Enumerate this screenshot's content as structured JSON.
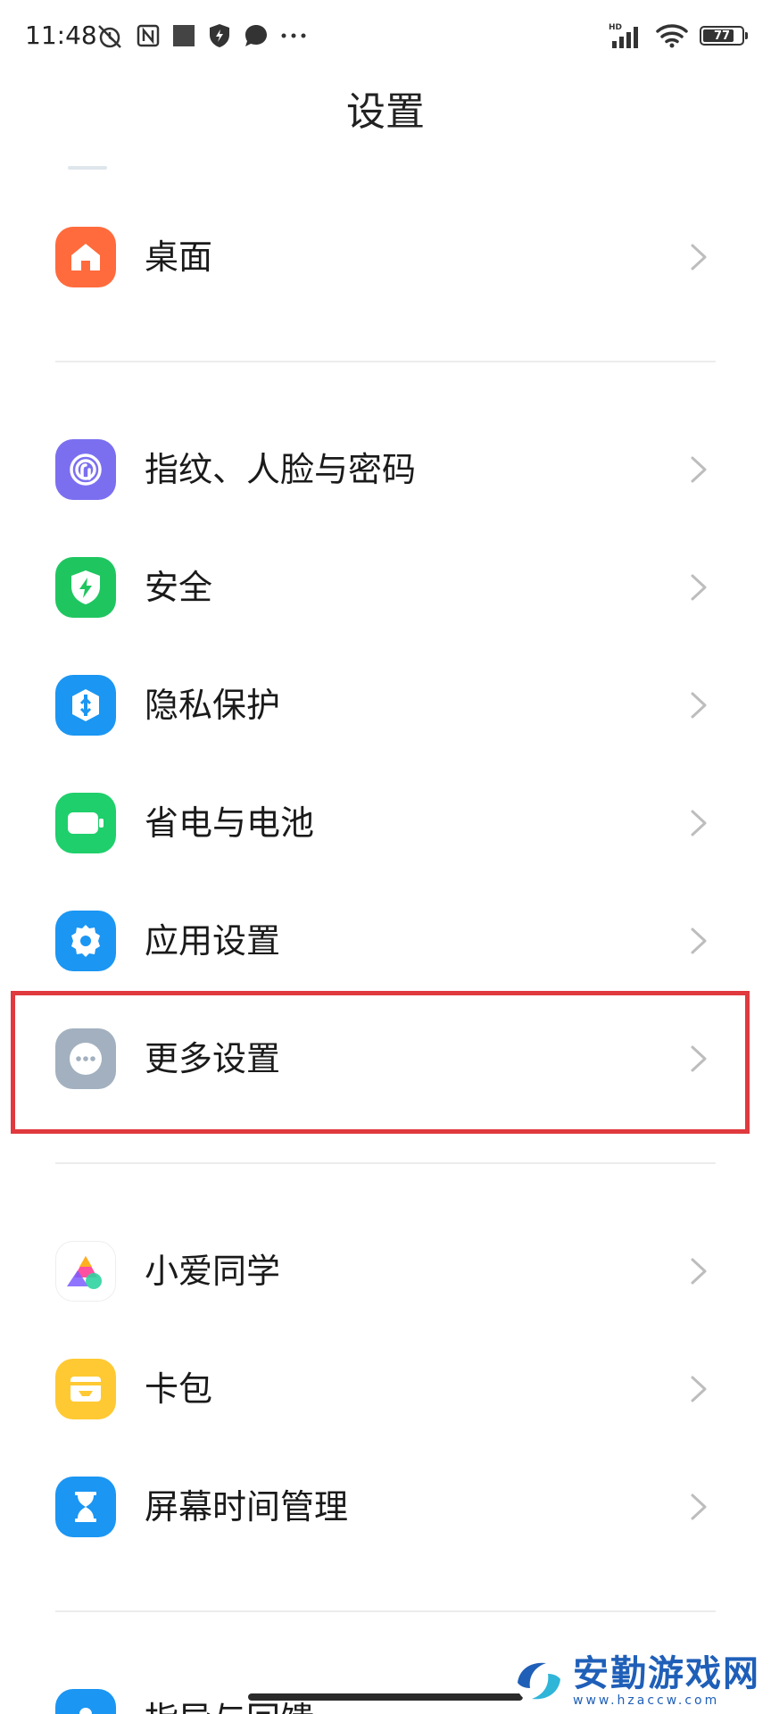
{
  "status_bar": {
    "time": "11:48",
    "network_badge": "HD",
    "battery_level": "77"
  },
  "header": {
    "title": "设置"
  },
  "settings_items": [
    {
      "label": "桌面",
      "icon": "home-icon",
      "color": "#ff6b3d"
    },
    {
      "label": "指纹、人脸与密码",
      "icon": "fingerprint-icon",
      "color": "#7b6ff0"
    },
    {
      "label": "安全",
      "icon": "shield-bolt-icon",
      "color": "#1fc660"
    },
    {
      "label": "隐私保护",
      "icon": "privacy-icon",
      "color": "#1b96f3"
    },
    {
      "label": "省电与电池",
      "icon": "battery-icon",
      "color": "#1fcf6b"
    },
    {
      "label": "应用设置",
      "icon": "gear-icon",
      "color": "#1b96f3"
    },
    {
      "label": "更多设置",
      "icon": "more-dots-icon",
      "color": "#a3b0bf"
    },
    {
      "label": "小爱同学",
      "icon": "xiaoai-icon",
      "color": "#ffffff"
    },
    {
      "label": "卡包",
      "icon": "wallet-icon",
      "color": "#ffc933"
    },
    {
      "label": "屏幕时间管理",
      "icon": "hourglass-icon",
      "color": "#1b96f3"
    },
    {
      "label": "指导与回馈",
      "icon": "person-icon",
      "color": "#1b96f3"
    }
  ],
  "highlighted_item": "更多设置",
  "watermark": {
    "title": "安勤游戏网",
    "subtitle": "www.hzaccw.com"
  }
}
